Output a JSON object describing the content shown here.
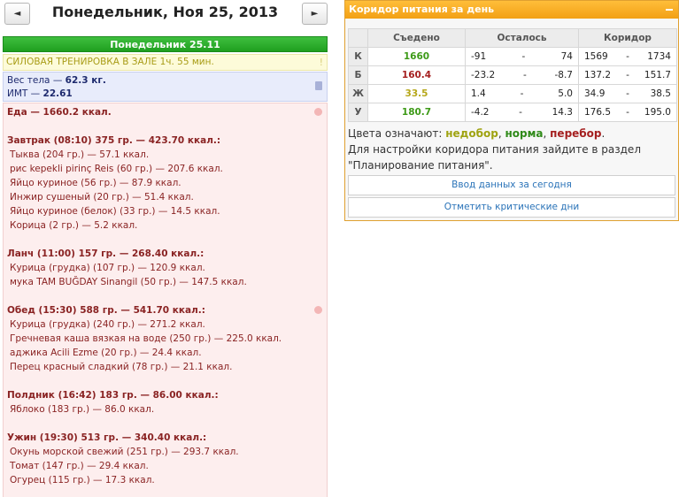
{
  "date_nav": {
    "prev_label": "◄",
    "next_label": "►",
    "title": "Понедельник, Ноя 25, 2013"
  },
  "day_header": "Понедельник 25.11",
  "training": {
    "text": "СИЛОВАЯ ТРЕНИРОВКА В ЗАЛЕ 1ч. 55 мин.",
    "mark": "!"
  },
  "body_stats": {
    "weight_label": "Вес тела — ",
    "weight_value": "62.3 кг.",
    "bmi_label": "ИМТ — ",
    "bmi_value": "22.61"
  },
  "food": {
    "total": "Еда — 1660.2 ккал.",
    "meals": [
      {
        "title": "Завтрак (08:10) 375 гр. — 423.70 ккал.:",
        "items": [
          "Тыква (204 гр.) — 57.1 ккал.",
          "рис kepekli pirinç Reis (60 гр.) — 207.6 ккал.",
          "Яйцо куриное (56 гр.) — 87.9 ккал.",
          "Инжир сушеный (20 гр.) — 51.4 ккал.",
          "Яйцо куриное (белок) (33 гр.) — 14.5 ккал.",
          "Корица (2 гр.) — 5.2 ккал."
        ]
      },
      {
        "title": "Ланч (11:00) 157 гр. — 268.40 ккал.:",
        "items": [
          "Курица (грудка) (107 гр.) — 120.9 ккал.",
          "мука TAM BUĞDAY Sinangil (50 гр.) — 147.5 ккал."
        ]
      },
      {
        "title": "Обед (15:30) 588 гр. — 541.70 ккал.:",
        "items": [
          "Курица (грудка) (240 гр.) — 271.2 ккал.",
          "Гречневая каша вязкая на воде (250 гр.) — 225.0 ккал.",
          "аджика Acili Ezme (20 гр.) — 24.4 ккал.",
          "Перец красный сладкий (78 гр.) — 21.1 ккал."
        ]
      },
      {
        "title": "Полдник (16:42) 183 гр. — 86.00 ккал.:",
        "items": [
          "Яблоко (183 гр.) — 86.0 ккал."
        ]
      },
      {
        "title": "Ужин (19:30) 513 гр. — 340.40 ккал.:",
        "items": [
          "Окунь морской свежий (251 гр.) — 293.7 ккал.",
          "Томат (147 гр.) — 29.4 ккал.",
          "Огурец (115 гр.) — 17.3 ккал."
        ]
      }
    ]
  },
  "corridor": {
    "title": "Коридор питания за день",
    "headers": {
      "eaten": "Съедено",
      "left": "Осталось",
      "range": "Коридор"
    },
    "dash": "-",
    "rows": [
      {
        "label": "К",
        "eaten": "1660",
        "eaten_status": "norm",
        "left_min": "-91",
        "left_max": "74",
        "range_min": "1569",
        "range_max": "1734"
      },
      {
        "label": "Б",
        "eaten": "160.4",
        "eaten_status": "over",
        "left_min": "-23.2",
        "left_max": "-8.7",
        "range_min": "137.2",
        "range_max": "151.7"
      },
      {
        "label": "Ж",
        "eaten": "33.5",
        "eaten_status": "under",
        "left_min": "1.4",
        "left_max": "5.0",
        "range_min": "34.9",
        "range_max": "38.5"
      },
      {
        "label": "У",
        "eaten": "180.7",
        "eaten_status": "norm",
        "left_min": "-4.2",
        "left_max": "14.3",
        "range_min": "176.5",
        "range_max": "195.0"
      }
    ],
    "legend": {
      "prefix": "Цвета означают: ",
      "under": "недобор",
      "sep1": ", ",
      "norm": "норма",
      "sep2": ", ",
      "over": "перебор",
      "suffix": ".",
      "hint": "Для настройки коридора питания зайдите в раздел \"Планирование питания\"."
    },
    "buttons": {
      "enter_data": "Ввод данных за сегодня",
      "critical_days": "Отметить критические дни"
    }
  },
  "colors": {
    "norm": "#3d9a17",
    "over": "#a52020",
    "under": "#b6a71a"
  }
}
